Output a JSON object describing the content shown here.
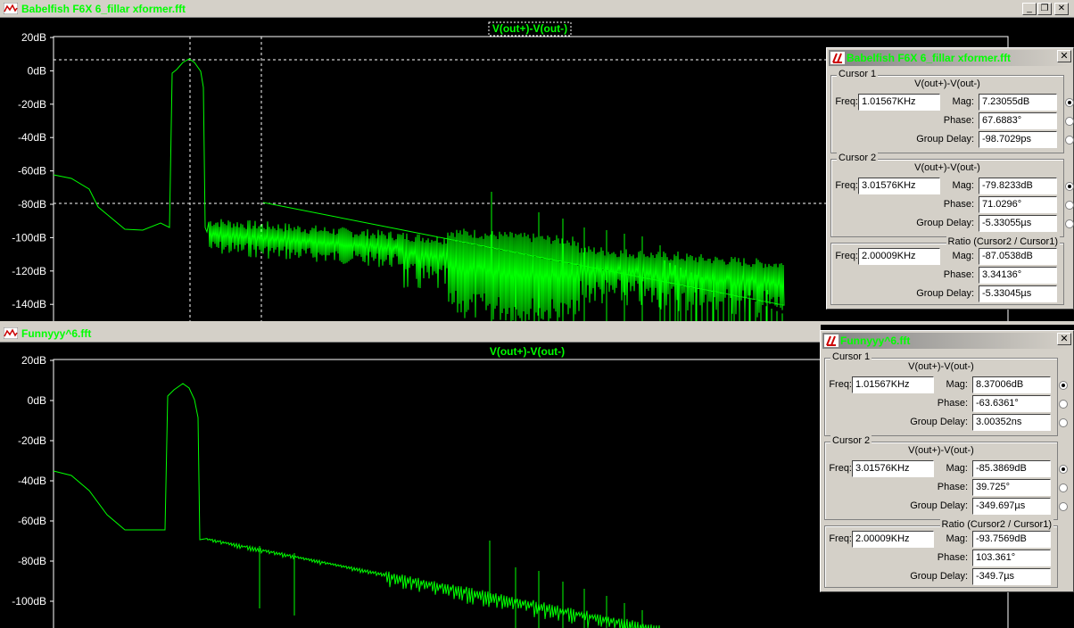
{
  "colors": {
    "trace": "#00ff00",
    "axis": "#ffffff",
    "cursor": "#ffffff"
  },
  "windows": [
    {
      "title": "Babelfish F6X 6_fillar xformer.fft",
      "trace_label": "V(out+)-V(out-)",
      "yticks": [
        "20dB",
        "0dB",
        "-20dB",
        "-40dB",
        "-60dB",
        "-80dB",
        "-100dB",
        "-120dB",
        "-140dB"
      ],
      "panel": {
        "title": "Babelfish F6X 6_fillar xformer.fft",
        "cursor1": {
          "label": "Cursor 1",
          "signal": "V(out+)-V(out-)",
          "freq": "1.01567KHz",
          "mag": "7.23055dB",
          "phase": "67.6883°",
          "group_delay": "-98.7029ps"
        },
        "cursor2": {
          "label": "Cursor 2",
          "signal": "V(out+)-V(out-)",
          "freq": "3.01576KHz",
          "mag": "-79.8233dB",
          "phase": "71.0296°",
          "group_delay": "-5.33055µs"
        },
        "ratio": {
          "label": "Ratio (Cursor2 / Cursor1)",
          "freq": "2.00009KHz",
          "mag": "-87.0538dB",
          "phase": "3.34136°",
          "group_delay": "-5.33045µs"
        }
      }
    },
    {
      "title": "Funnyyy^6.fft",
      "trace_label": "V(out+)-V(out-)",
      "yticks": [
        "20dB",
        "0dB",
        "-20dB",
        "-40dB",
        "-60dB",
        "-80dB",
        "-100dB"
      ],
      "panel": {
        "title": "Funnyyy^6.fft",
        "cursor1": {
          "label": "Cursor 1",
          "signal": "V(out+)-V(out-)",
          "freq": "1.01567KHz",
          "mag": "8.37006dB",
          "phase": "-63.6361°",
          "group_delay": "3.00352ns"
        },
        "cursor2": {
          "label": "Cursor 2",
          "signal": "V(out+)-V(out-)",
          "freq": "3.01576KHz",
          "mag": "-85.3869dB",
          "phase": "39.725°",
          "group_delay": "-349.697µs"
        },
        "ratio": {
          "label": "Ratio (Cursor2 / Cursor1)",
          "freq": "2.00009KHz",
          "mag": "-93.7569dB",
          "phase": "103.361°",
          "group_delay": "-349.7µs"
        }
      }
    }
  ],
  "labels": {
    "freq": "Freq:",
    "mag": "Mag:",
    "phase": "Phase:",
    "group_delay": "Group Delay:"
  },
  "buttons": {
    "minimize": "_",
    "restore": "❐",
    "close": "✕"
  }
}
